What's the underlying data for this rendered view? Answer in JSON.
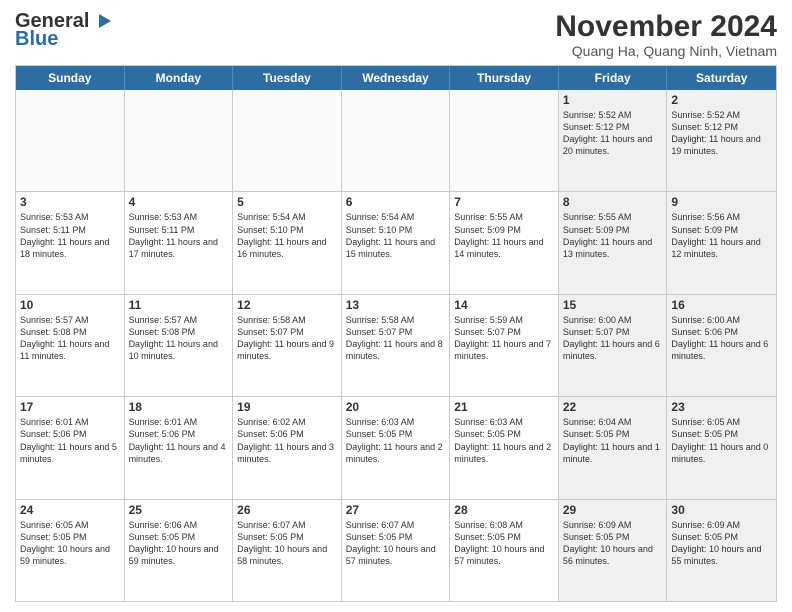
{
  "header": {
    "logo_line1": "General",
    "logo_line2": "Blue",
    "month": "November 2024",
    "location": "Quang Ha, Quang Ninh, Vietnam"
  },
  "days_of_week": [
    "Sunday",
    "Monday",
    "Tuesday",
    "Wednesday",
    "Thursday",
    "Friday",
    "Saturday"
  ],
  "weeks": [
    [
      {
        "day": "",
        "text": "",
        "empty": true
      },
      {
        "day": "",
        "text": "",
        "empty": true
      },
      {
        "day": "",
        "text": "",
        "empty": true
      },
      {
        "day": "",
        "text": "",
        "empty": true
      },
      {
        "day": "",
        "text": "",
        "empty": true
      },
      {
        "day": "1",
        "text": "Sunrise: 5:52 AM\nSunset: 5:12 PM\nDaylight: 11 hours and 20 minutes.",
        "shaded": true
      },
      {
        "day": "2",
        "text": "Sunrise: 5:52 AM\nSunset: 5:12 PM\nDaylight: 11 hours and 19 minutes.",
        "shaded": true
      }
    ],
    [
      {
        "day": "3",
        "text": "Sunrise: 5:53 AM\nSunset: 5:11 PM\nDaylight: 11 hours and 18 minutes."
      },
      {
        "day": "4",
        "text": "Sunrise: 5:53 AM\nSunset: 5:11 PM\nDaylight: 11 hours and 17 minutes."
      },
      {
        "day": "5",
        "text": "Sunrise: 5:54 AM\nSunset: 5:10 PM\nDaylight: 11 hours and 16 minutes."
      },
      {
        "day": "6",
        "text": "Sunrise: 5:54 AM\nSunset: 5:10 PM\nDaylight: 11 hours and 15 minutes."
      },
      {
        "day": "7",
        "text": "Sunrise: 5:55 AM\nSunset: 5:09 PM\nDaylight: 11 hours and 14 minutes."
      },
      {
        "day": "8",
        "text": "Sunrise: 5:55 AM\nSunset: 5:09 PM\nDaylight: 11 hours and 13 minutes.",
        "shaded": true
      },
      {
        "day": "9",
        "text": "Sunrise: 5:56 AM\nSunset: 5:09 PM\nDaylight: 11 hours and 12 minutes.",
        "shaded": true
      }
    ],
    [
      {
        "day": "10",
        "text": "Sunrise: 5:57 AM\nSunset: 5:08 PM\nDaylight: 11 hours and 11 minutes."
      },
      {
        "day": "11",
        "text": "Sunrise: 5:57 AM\nSunset: 5:08 PM\nDaylight: 11 hours and 10 minutes."
      },
      {
        "day": "12",
        "text": "Sunrise: 5:58 AM\nSunset: 5:07 PM\nDaylight: 11 hours and 9 minutes."
      },
      {
        "day": "13",
        "text": "Sunrise: 5:58 AM\nSunset: 5:07 PM\nDaylight: 11 hours and 8 minutes."
      },
      {
        "day": "14",
        "text": "Sunrise: 5:59 AM\nSunset: 5:07 PM\nDaylight: 11 hours and 7 minutes."
      },
      {
        "day": "15",
        "text": "Sunrise: 6:00 AM\nSunset: 5:07 PM\nDaylight: 11 hours and 6 minutes.",
        "shaded": true
      },
      {
        "day": "16",
        "text": "Sunrise: 6:00 AM\nSunset: 5:06 PM\nDaylight: 11 hours and 6 minutes.",
        "shaded": true
      }
    ],
    [
      {
        "day": "17",
        "text": "Sunrise: 6:01 AM\nSunset: 5:06 PM\nDaylight: 11 hours and 5 minutes."
      },
      {
        "day": "18",
        "text": "Sunrise: 6:01 AM\nSunset: 5:06 PM\nDaylight: 11 hours and 4 minutes."
      },
      {
        "day": "19",
        "text": "Sunrise: 6:02 AM\nSunset: 5:06 PM\nDaylight: 11 hours and 3 minutes."
      },
      {
        "day": "20",
        "text": "Sunrise: 6:03 AM\nSunset: 5:05 PM\nDaylight: 11 hours and 2 minutes."
      },
      {
        "day": "21",
        "text": "Sunrise: 6:03 AM\nSunset: 5:05 PM\nDaylight: 11 hours and 2 minutes."
      },
      {
        "day": "22",
        "text": "Sunrise: 6:04 AM\nSunset: 5:05 PM\nDaylight: 11 hours and 1 minute.",
        "shaded": true
      },
      {
        "day": "23",
        "text": "Sunrise: 6:05 AM\nSunset: 5:05 PM\nDaylight: 11 hours and 0 minutes.",
        "shaded": true
      }
    ],
    [
      {
        "day": "24",
        "text": "Sunrise: 6:05 AM\nSunset: 5:05 PM\nDaylight: 10 hours and 59 minutes."
      },
      {
        "day": "25",
        "text": "Sunrise: 6:06 AM\nSunset: 5:05 PM\nDaylight: 10 hours and 59 minutes."
      },
      {
        "day": "26",
        "text": "Sunrise: 6:07 AM\nSunset: 5:05 PM\nDaylight: 10 hours and 58 minutes."
      },
      {
        "day": "27",
        "text": "Sunrise: 6:07 AM\nSunset: 5:05 PM\nDaylight: 10 hours and 57 minutes."
      },
      {
        "day": "28",
        "text": "Sunrise: 6:08 AM\nSunset: 5:05 PM\nDaylight: 10 hours and 57 minutes."
      },
      {
        "day": "29",
        "text": "Sunrise: 6:09 AM\nSunset: 5:05 PM\nDaylight: 10 hours and 56 minutes.",
        "shaded": true
      },
      {
        "day": "30",
        "text": "Sunrise: 6:09 AM\nSunset: 5:05 PM\nDaylight: 10 hours and 55 minutes.",
        "shaded": true
      }
    ]
  ]
}
